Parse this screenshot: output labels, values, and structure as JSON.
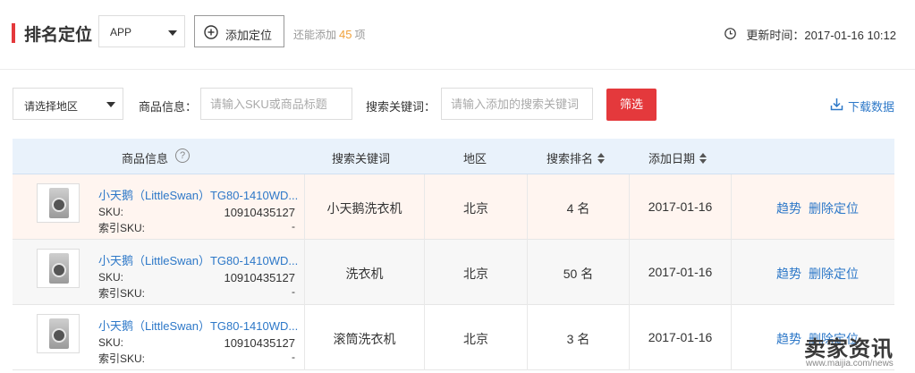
{
  "header": {
    "title": "排名定位",
    "platform_select": "APP",
    "add_button": "添加定位",
    "remaining_prefix": "还能添加",
    "remaining_count": "45",
    "remaining_suffix": "项",
    "update_label": "更新时间：2017-01-16 10:12"
  },
  "filters": {
    "region_select": "请选择地区",
    "product_label": "商品信息：",
    "product_placeholder": "请输入SKU或商品标题",
    "keyword_label": "搜索关键词：",
    "keyword_placeholder": "请输入添加的搜索关键词",
    "screen_button": "筛选",
    "download": "下载数据"
  },
  "table": {
    "headers": {
      "product": "商品信息",
      "help": "?",
      "keyword": "搜索关键词",
      "region": "地区",
      "rank": "搜索排名",
      "date": "添加日期"
    },
    "rows": [
      {
        "name": "小天鹅（LittleSwan）TG80-1410WD...",
        "sku_label": "SKU:",
        "sku": "10910435127",
        "index_label": "索引SKU:",
        "index_sku": "-",
        "keyword": "小天鹅洗衣机",
        "region": "北京",
        "rank": "4 名",
        "date": "2017-01-16",
        "trend": "趋势",
        "delete": "删除定位"
      },
      {
        "name": "小天鹅（LittleSwan）TG80-1410WD...",
        "sku_label": "SKU:",
        "sku": "10910435127",
        "index_label": "索引SKU:",
        "index_sku": "-",
        "keyword": "洗衣机",
        "region": "北京",
        "rank": "50 名",
        "date": "2017-01-16",
        "trend": "趋势",
        "delete": "删除定位"
      },
      {
        "name": "小天鹅（LittleSwan）TG80-1410WD...",
        "sku_label": "SKU:",
        "sku": "10910435127",
        "index_label": "索引SKU:",
        "index_sku": "-",
        "keyword": "滚筒洗衣机",
        "region": "北京",
        "rank": "3 名",
        "date": "2017-01-16",
        "trend": "趋势",
        "delete": "删除定位"
      }
    ]
  },
  "watermark": {
    "big": "卖家资讯",
    "small": "www.maijia.com/news"
  },
  "colors": {
    "accent": "#e4393c",
    "link": "#2d78c8",
    "count": "#f0a13a",
    "header_bg": "#e9f2fb",
    "row_highlight": "#fff5f0",
    "row_alt": "#f7f7f7"
  },
  "icons": [
    "plus-circle-icon",
    "clock-icon",
    "download-icon",
    "caret-down-icon",
    "sort-icon",
    "help-icon"
  ]
}
